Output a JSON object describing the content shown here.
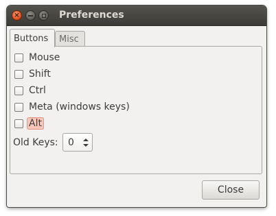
{
  "window": {
    "title": "Preferences",
    "close_glyph": "×"
  },
  "tabs": [
    {
      "label": "Buttons",
      "active": true
    },
    {
      "label": "Misc",
      "active": false
    }
  ],
  "buttons_tab": {
    "checkboxes": [
      {
        "label": "Mouse",
        "checked": false
      },
      {
        "label": "Shift",
        "checked": false
      },
      {
        "label": "Ctrl",
        "checked": false
      },
      {
        "label": "Meta (windows keys)",
        "checked": false
      },
      {
        "label": "Alt",
        "checked": false,
        "focused": true
      }
    ],
    "old_keys": {
      "label": "Old Keys:",
      "value": "0"
    }
  },
  "footer": {
    "close_label": "Close"
  },
  "colors": {
    "titlebar": "#3c3b37",
    "title_text": "#dfdbd2",
    "window_bg": "#f2f1f0",
    "close_button": "#df4a16",
    "focus_highlight": "#f7c7bb"
  }
}
